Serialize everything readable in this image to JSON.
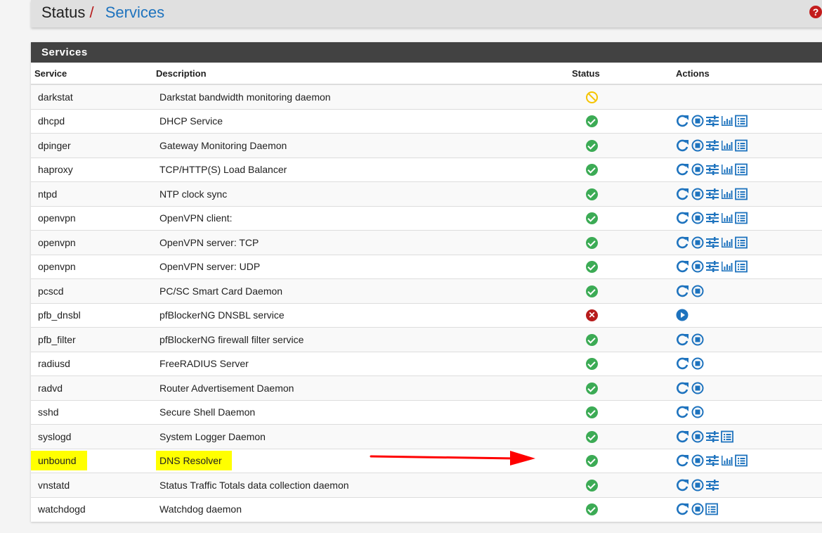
{
  "header": {
    "breadcrumb_root": "Status",
    "breadcrumb_separator": "/",
    "breadcrumb_current": "Services",
    "help_icon": "question-circle-icon"
  },
  "panel": {
    "title": "Services",
    "columns": [
      "Service",
      "Description",
      "Status",
      "Actions"
    ],
    "rows": [
      {
        "service": "darkstat",
        "description": "Darkstat bandwidth monitoring daemon",
        "status": "disabled",
        "actions": []
      },
      {
        "service": "dhcpd",
        "description": "DHCP Service",
        "status": "running",
        "actions": [
          "restart",
          "stop",
          "settings",
          "status",
          "logs"
        ]
      },
      {
        "service": "dpinger",
        "description": "Gateway Monitoring Daemon",
        "status": "running",
        "actions": [
          "restart",
          "stop",
          "settings",
          "status",
          "logs"
        ]
      },
      {
        "service": "haproxy",
        "description": "TCP/HTTP(S) Load Balancer",
        "status": "running",
        "actions": [
          "restart",
          "stop",
          "settings",
          "status",
          "logs"
        ]
      },
      {
        "service": "ntpd",
        "description": "NTP clock sync",
        "status": "running",
        "actions": [
          "restart",
          "stop",
          "settings",
          "status",
          "logs"
        ]
      },
      {
        "service": "openvpn",
        "description": "OpenVPN client:",
        "status": "running",
        "actions": [
          "restart",
          "stop",
          "settings",
          "status",
          "logs"
        ]
      },
      {
        "service": "openvpn",
        "description": "OpenVPN server: TCP",
        "status": "running",
        "actions": [
          "restart",
          "stop",
          "settings",
          "status",
          "logs"
        ]
      },
      {
        "service": "openvpn",
        "description": "OpenVPN server: UDP",
        "status": "running",
        "actions": [
          "restart",
          "stop",
          "settings",
          "status",
          "logs"
        ]
      },
      {
        "service": "pcscd",
        "description": "PC/SC Smart Card Daemon",
        "status": "running",
        "actions": [
          "restart",
          "stop"
        ]
      },
      {
        "service": "pfb_dnsbl",
        "description": "pfBlockerNG DNSBL service",
        "status": "stopped",
        "actions": [
          "start"
        ]
      },
      {
        "service": "pfb_filter",
        "description": "pfBlockerNG firewall filter service",
        "status": "running",
        "actions": [
          "restart",
          "stop"
        ]
      },
      {
        "service": "radiusd",
        "description": "FreeRADIUS Server",
        "status": "running",
        "actions": [
          "restart",
          "stop"
        ]
      },
      {
        "service": "radvd",
        "description": "Router Advertisement Daemon",
        "status": "running",
        "actions": [
          "restart",
          "stop"
        ]
      },
      {
        "service": "sshd",
        "description": "Secure Shell Daemon",
        "status": "running",
        "actions": [
          "restart",
          "stop"
        ]
      },
      {
        "service": "syslogd",
        "description": "System Logger Daemon",
        "status": "running",
        "actions": [
          "restart",
          "stop",
          "settings",
          "logs"
        ]
      },
      {
        "service": "unbound",
        "description": "DNS Resolver",
        "status": "running",
        "actions": [
          "restart",
          "stop",
          "settings",
          "status",
          "logs"
        ],
        "highlighted": true
      },
      {
        "service": "vnstatd",
        "description": "Status Traffic Totals data collection daemon",
        "status": "running",
        "actions": [
          "restart",
          "stop",
          "settings"
        ]
      },
      {
        "service": "watchdogd",
        "description": "Watchdog daemon",
        "status": "running",
        "actions": [
          "restart",
          "stop",
          "logs"
        ]
      }
    ]
  },
  "colors": {
    "accent": "#1e73be",
    "running": "#3cab55",
    "stopped": "#b71c1c",
    "disabled": "#f5c400",
    "highlight": "#ffff00",
    "annotation_arrow": "#ff0000"
  },
  "annotation": {
    "type": "arrow",
    "points_to": "unbound status"
  }
}
